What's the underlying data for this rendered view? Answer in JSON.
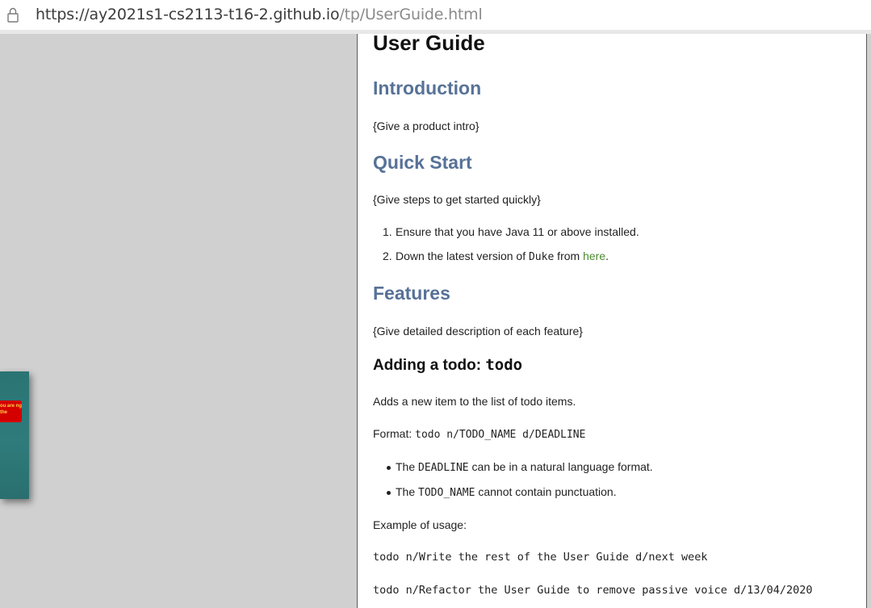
{
  "browser": {
    "url_host": "https://ay2021s1-cs2113-t16-2.github.io",
    "url_path": "/tp/UserGuide.html",
    "lock_icon": "lock-icon"
  },
  "thumbnail": {
    "badge_text": "ou are ng the"
  },
  "doc": {
    "title": "User Guide",
    "intro": {
      "heading": "Introduction",
      "text": "{Give a product intro}"
    },
    "quickstart": {
      "heading": "Quick Start",
      "text": "{Give steps to get started quickly}",
      "steps": [
        {
          "num": "1.",
          "text": "Ensure that you have Java 11 or above installed."
        },
        {
          "num": "2.",
          "pre": "Down the latest version of ",
          "code": "Duke",
          "mid": " from ",
          "link": "here",
          "post": "."
        }
      ]
    },
    "features": {
      "heading": "Features",
      "text": "{Give detailed description of each feature}"
    },
    "todo": {
      "heading_text": "Adding a todo: ",
      "heading_code": "todo",
      "desc": "Adds a new item to the list of todo items.",
      "format_label": "Format: ",
      "format_code": "todo n/TODO_NAME d/DEADLINE",
      "bullets": [
        {
          "pre": "The ",
          "code": "DEADLINE",
          "post": " can be in a natural language format."
        },
        {
          "pre": "The ",
          "code": "TODO_NAME",
          "post": " cannot contain punctuation."
        }
      ],
      "example_label": "Example of usage:",
      "examples": [
        "todo n/Write the rest of the User Guide d/next week",
        "todo n/Refactor the User Guide to remove passive voice d/13/04/2020"
      ]
    }
  }
}
